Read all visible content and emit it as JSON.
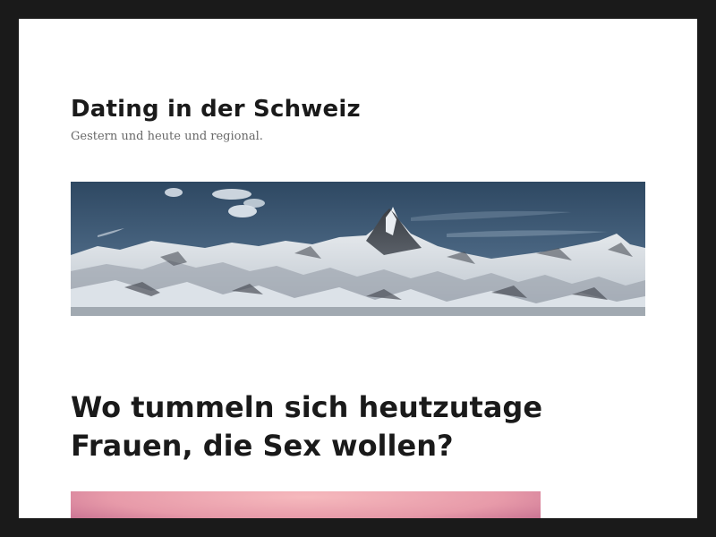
{
  "site": {
    "title": "Dating in der Schweiz",
    "description": "Gestern und heute und regional."
  },
  "header_image": {
    "subject": "Matterhorn snowy mountain panorama"
  },
  "post": {
    "title": "Wo tummeln sich heutzutage Frauen, die Sex wollen?"
  },
  "colors": {
    "background": "#1a1a1a",
    "page": "#ffffff",
    "text": "#1a1a1a",
    "muted": "#686868",
    "sky": "#3d5670",
    "thumbnail_pink": "#e8a0b0"
  },
  "icons": []
}
